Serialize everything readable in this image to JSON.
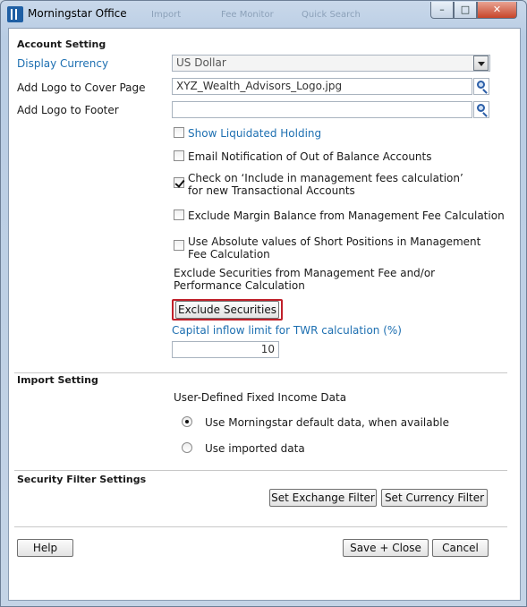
{
  "window": {
    "title": "Morningstar Office",
    "background_tabs": [
      "Import",
      "Fee Monitor",
      "Quick Search"
    ],
    "controls": {
      "minimize": "–",
      "maximize": "□",
      "close": "✕"
    }
  },
  "icons": {
    "app_logo": "morningstar-logo-icon",
    "browse": "magnifier-icon",
    "dropdown": "chevron-down-icon"
  },
  "colors": {
    "link": "#1d6fb1",
    "highlight": "#c0202a"
  },
  "account_setting": {
    "title": "Account Setting",
    "display_currency_label": "Display Currency",
    "display_currency_value": "US Dollar",
    "logo_cover_label": "Add Logo to Cover Page",
    "logo_cover_value": "XYZ_Wealth_Advisors_Logo.jpg",
    "logo_footer_label": "Add Logo to Footer",
    "logo_footer_value": "",
    "options": [
      {
        "label": "Show Liquidated Holding",
        "checked": false
      },
      {
        "label": "Email Notification of Out of Balance Accounts",
        "checked": false
      },
      {
        "label_line1": "Check on ‘Include in management fees calculation’",
        "label_line2": "for new Transactional Accounts",
        "checked": true
      },
      {
        "label": "Exclude Margin Balance from Management Fee Calculation",
        "checked": false
      },
      {
        "label_line1": "Use Absolute values of Short Positions in Management",
        "label_line2": "Fee Calculation",
        "checked": false
      }
    ],
    "exclude_text_line1": "Exclude Securities from Management Fee and/or",
    "exclude_text_line2": "Performance Calculation",
    "exclude_button": "Exclude Securities",
    "capital_inflow_label": "Capital inflow limit for TWR calculation (%)",
    "capital_inflow_value": "10"
  },
  "import_setting": {
    "title": "Import Setting",
    "subtitle": "User-Defined Fixed Income Data",
    "options": [
      {
        "label": "Use Morningstar default data, when available",
        "selected": true
      },
      {
        "label": "Use imported data",
        "selected": false
      }
    ]
  },
  "security_filter": {
    "title": "Security Filter Settings",
    "exchange_button": "Set Exchange Filter",
    "currency_button": "Set Currency Filter"
  },
  "footer": {
    "help": "Help",
    "save_close": "Save + Close",
    "cancel": "Cancel"
  }
}
